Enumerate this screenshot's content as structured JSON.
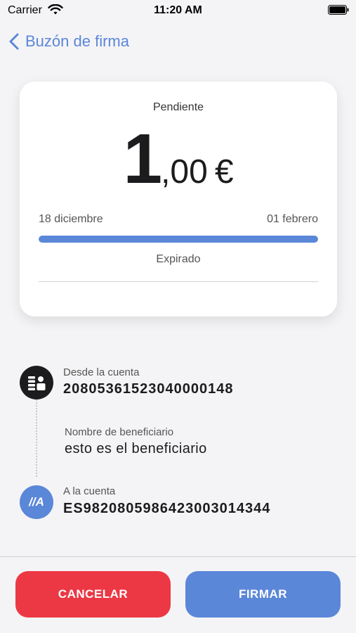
{
  "status_bar": {
    "carrier": "Carrier",
    "time": "11:20 AM"
  },
  "nav": {
    "back_label": "Buzón de firma"
  },
  "card": {
    "status": "Pendiente",
    "amount_integer": "1",
    "amount_decimal": ",00",
    "currency": "€",
    "start_date": "18 diciembre",
    "end_date": "01 febrero",
    "progress_fraction": 1.0,
    "progress_color": "#5b87d9",
    "state_label": "Expirado"
  },
  "transfer": {
    "from_label": "Desde la cuenta",
    "from_account": "20805361523040000148",
    "beneficiary_label": "Nombre de beneficiario",
    "beneficiary_name": "esto es el beneficiario",
    "to_label": "A la cuenta",
    "to_account": "ES9820805986423003014344",
    "to_icon_text": "//A"
  },
  "actions": {
    "cancel_label": "CANCELAR",
    "sign_label": "FIRMAR",
    "cancel_color": "#ec3844",
    "sign_color": "#5b87d9"
  },
  "icons": {
    "from_icon": "bank-account-icon",
    "to_icon": "bank-logo-icon",
    "back": "chevron-left-icon"
  }
}
